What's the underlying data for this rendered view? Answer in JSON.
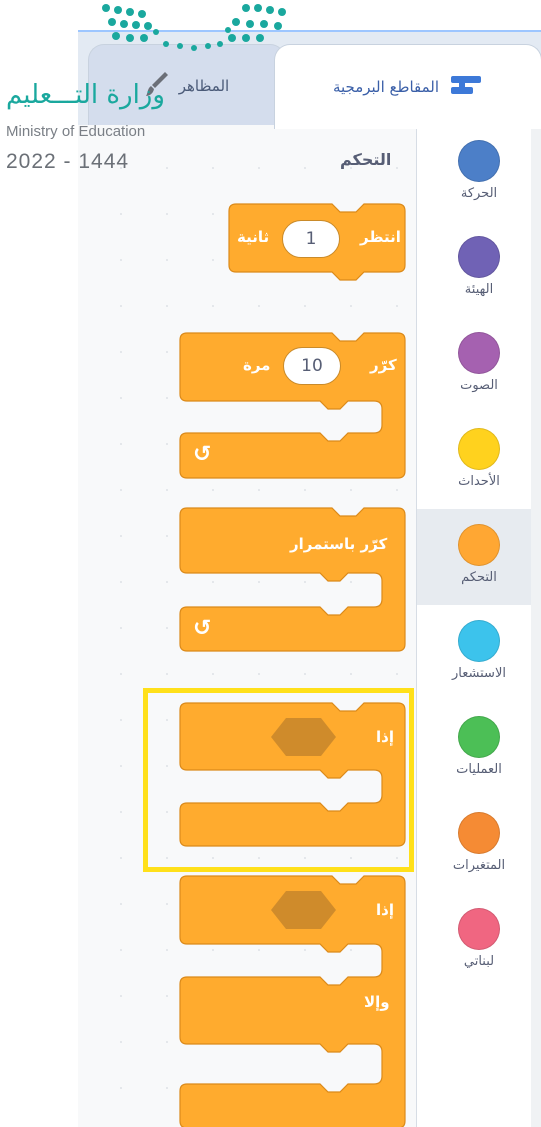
{
  "logo": {
    "arabic": "وزارة التـــعليم",
    "english": "Ministry of Education",
    "year": "2022 - 1444"
  },
  "tabs": {
    "code": "المقاطع البرمجية",
    "costumes": "المظاهر"
  },
  "palette": {
    "section_title": "التحكم",
    "blocks": {
      "wait": {
        "label": "انتظر",
        "value": "1",
        "unit": "ثانية"
      },
      "repeat": {
        "label": "كرّر",
        "value": "10",
        "unit": "مرة"
      },
      "forever": {
        "label": "كرّر باستمرار"
      },
      "if": {
        "label": "إذا"
      },
      "if_else": {
        "label": "إذا",
        "else_label": "وإلا"
      }
    }
  },
  "categories": [
    {
      "label": "الحركة",
      "color": "#4C7FC8",
      "selected": false
    },
    {
      "label": "الهيئة",
      "color": "#7062B5",
      "selected": false
    },
    {
      "label": "الصوت",
      "color": "#A561B0",
      "selected": false
    },
    {
      "label": "الأحداث",
      "color": "#FFD21E",
      "selected": false
    },
    {
      "label": "التحكم",
      "color": "#FFA733",
      "selected": true
    },
    {
      "label": "الاستشعار",
      "color": "#3CC3EC",
      "selected": false
    },
    {
      "label": "العمليات",
      "color": "#4CBF56",
      "selected": false
    },
    {
      "label": "المتغيرات",
      "color": "#F58B34",
      "selected": false
    },
    {
      "label": "لبناتي",
      "color": "#F06681",
      "selected": false
    }
  ],
  "colors": {
    "block_fill": "#FFAB2E",
    "block_stroke": "#DB8A1A",
    "hexagon": "#CF8B2B",
    "highlight": "#FFE01A"
  }
}
